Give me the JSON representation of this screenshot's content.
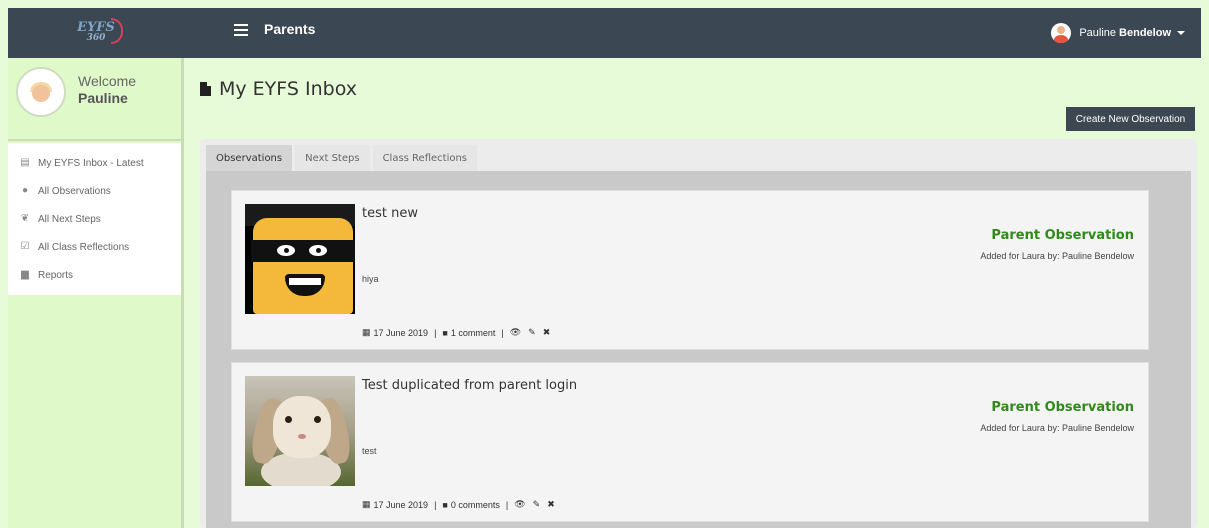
{
  "topbar": {
    "logo_text": "EYFS",
    "logo_num": "360",
    "title": "Parents",
    "user_first": "Pauline",
    "user_last": "Bendelow"
  },
  "sidebar": {
    "welcome": "Welcome",
    "name": "Pauline",
    "items": [
      {
        "label": "My EYFS Inbox - Latest",
        "icon": "inbox-icon"
      },
      {
        "label": "All Observations",
        "icon": "pin-icon"
      },
      {
        "label": "All Next Steps",
        "icon": "leaf-icon"
      },
      {
        "label": "All Class Reflections",
        "icon": "check-square-icon"
      },
      {
        "label": "Reports",
        "icon": "file-icon"
      }
    ]
  },
  "main": {
    "page_title": "My EYFS Inbox",
    "create_button": "Create New Observation",
    "tabs": [
      {
        "label": "Observations",
        "active": true
      },
      {
        "label": "Next Steps",
        "active": false
      },
      {
        "label": "Class Reflections",
        "active": false
      }
    ],
    "observations": [
      {
        "title": "test new",
        "text": "hiya",
        "type": "Parent Observation",
        "added": "Added for Laura by: Pauline Bendelow",
        "date": "17 June 2019",
        "comments": "1 comment",
        "image": "lego-figure"
      },
      {
        "title": "Test duplicated from parent login",
        "text": "test",
        "type": "Parent Observation",
        "added": "Added for Laura by: Pauline Bendelow",
        "date": "17 June 2019",
        "comments": "0 comments",
        "image": "rabbit"
      }
    ]
  },
  "colors": {
    "topbar": "#3b4752",
    "background": "#e8fbd9",
    "observation_type": "#2e8b19",
    "button": "#3d4752"
  }
}
